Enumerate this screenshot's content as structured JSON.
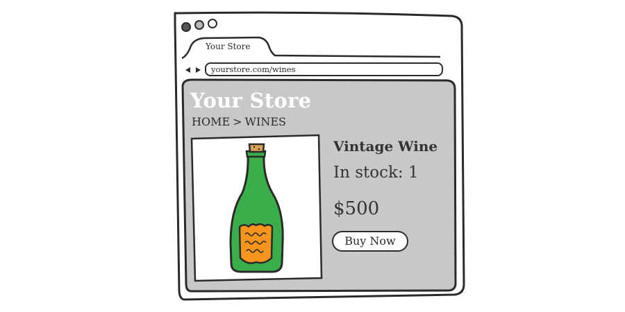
{
  "browser": {
    "tab_title": "Your Store",
    "url": "yourstore.com/wines"
  },
  "store": {
    "title": "Your Store",
    "breadcrumb": [
      "HOME",
      "WINES"
    ],
    "breadcrumb_separator": ">"
  },
  "product": {
    "name": "Vintage Wine",
    "stock": "In stock: 1",
    "price": "$500",
    "buy_label": "Buy Now",
    "image_icon": "wine-bottle-icon"
  },
  "colors": {
    "content_bg": "#c8c8c8",
    "bottle_green": "#3aae4a",
    "label_orange": "#f7941d",
    "cork": "#d9a35a",
    "outline": "#2a2a2a"
  }
}
